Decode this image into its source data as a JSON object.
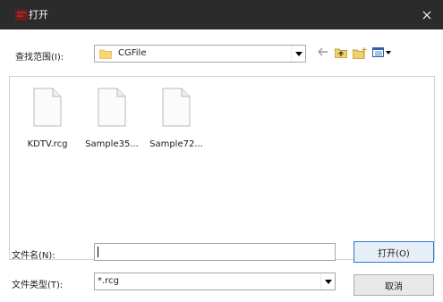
{
  "window": {
    "title": "打开",
    "close_glyph": "×"
  },
  "lookin": {
    "label": "查找范围(I):",
    "value": "CGFile"
  },
  "files": [
    {
      "name": "KDTV.rcg"
    },
    {
      "name": "Sample35..."
    },
    {
      "name": "Sample72..."
    }
  ],
  "filename": {
    "label": "文件名(N):",
    "value": ""
  },
  "filetype": {
    "label": "文件类型(T):",
    "value": "*.rcg"
  },
  "buttons": {
    "open": "打开(O)",
    "cancel": "取消"
  }
}
